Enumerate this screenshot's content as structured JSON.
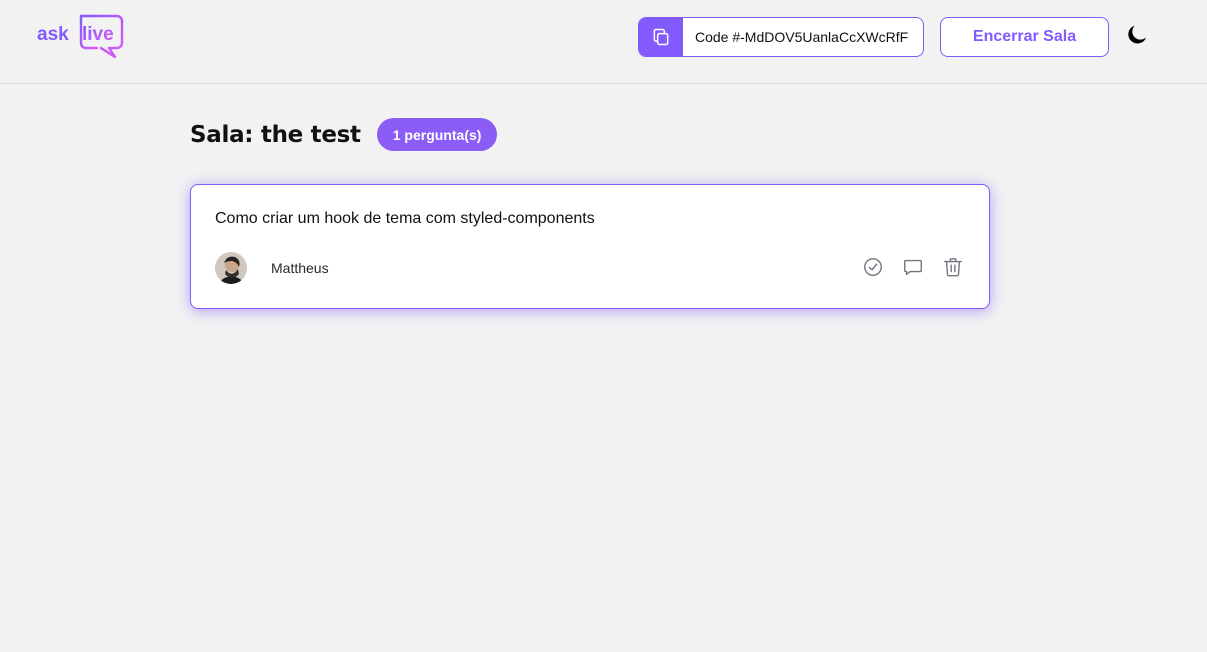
{
  "header": {
    "logo": {
      "word1": "ask",
      "word2": "live"
    },
    "room_code": {
      "label": "Code #-MdDOV5UanlaCcXWcRfF",
      "icon": "copy-icon"
    },
    "close_room_label": "Encerrar Sala",
    "theme_toggle_icon": "moon-icon"
  },
  "room": {
    "title": "Sala: the test",
    "question_count": "1 pergunta(s)"
  },
  "questions": [
    {
      "content": "Como criar um hook de tema com styled-components",
      "author": {
        "name": "Mattheus"
      },
      "actions": [
        "check-circle-icon",
        "answer-icon",
        "trash-icon"
      ]
    }
  ],
  "colors": {
    "accent": "#835afd",
    "badge": "#8b5cf6",
    "logo_pink": "#e559f9",
    "background": "#f2f2f2"
  }
}
